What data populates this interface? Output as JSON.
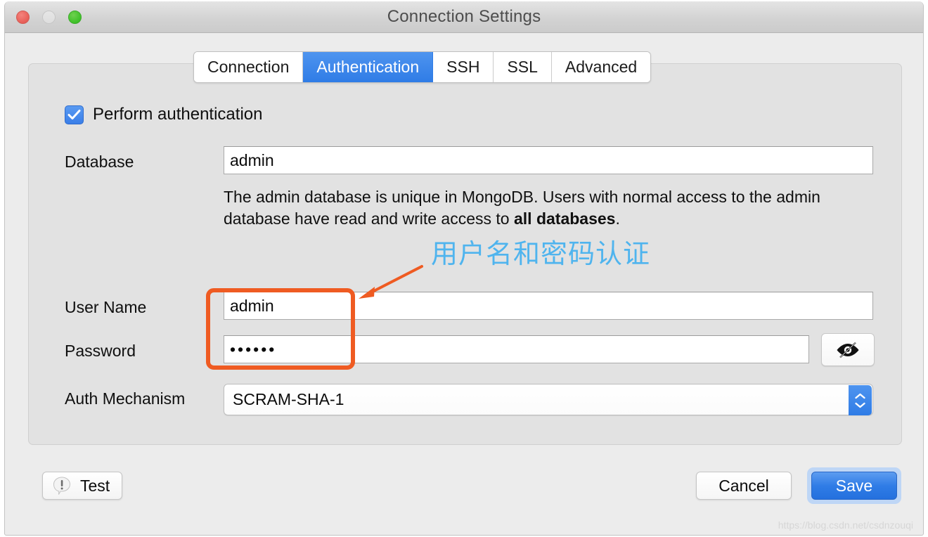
{
  "window": {
    "title": "Connection Settings",
    "traffic_lights": {
      "close": "close-button",
      "minimize": "minimize-button",
      "maximize": "maximize-button"
    }
  },
  "tabs": [
    {
      "label": "Connection",
      "active": false
    },
    {
      "label": "Authentication",
      "active": true
    },
    {
      "label": "SSH",
      "active": false
    },
    {
      "label": "SSL",
      "active": false
    },
    {
      "label": "Advanced",
      "active": false
    }
  ],
  "form": {
    "perform_auth": {
      "label": "Perform authentication",
      "checked": true
    },
    "database": {
      "label": "Database",
      "value": "admin",
      "help_prefix": "The admin database is unique in MongoDB. Users with normal access to the admin database have read and write access to ",
      "help_bold": "all databases",
      "help_suffix": "."
    },
    "username": {
      "label": "User Name",
      "value": "admin"
    },
    "password": {
      "label": "Password",
      "value": "••••••",
      "toggle_icon": "eye-slash-icon"
    },
    "auth_mechanism": {
      "label": "Auth Mechanism",
      "value": "SCRAM-SHA-1",
      "stepper_icon": "stepper-up-down-icon"
    }
  },
  "annotations": {
    "note_text": "用户名和密码认证",
    "note_color": "#4FB4EE",
    "highlight_color": "#EF5B22"
  },
  "footer": {
    "test_label": "Test",
    "test_icon": "alert-bubble-icon",
    "cancel_label": "Cancel",
    "save_label": "Save"
  },
  "watermark": "https://blog.csdn.net/csdnzouqi",
  "colors": {
    "accent_blue": "#2f7ce6",
    "annotation_blue": "#4FB4EE",
    "annotation_orange": "#EF5B22",
    "panel_gray": "#e2e2e2",
    "window_gray": "#ececec"
  }
}
